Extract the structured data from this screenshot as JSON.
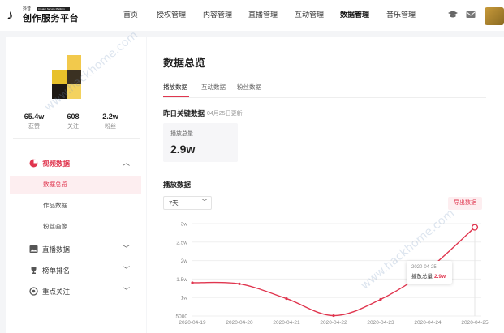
{
  "logo": {
    "small_text": "抖音",
    "badge_text": "Creator Service Platform",
    "title": "创作服务平台",
    "mark": "♪"
  },
  "nav": {
    "items": [
      {
        "label": "首页",
        "active": false
      },
      {
        "label": "授权管理",
        "active": false
      },
      {
        "label": "内容管理",
        "active": false
      },
      {
        "label": "直播管理",
        "active": false
      },
      {
        "label": "互动管理",
        "active": false
      },
      {
        "label": "数据管理",
        "active": true
      },
      {
        "label": "音乐管理",
        "active": false
      }
    ],
    "icons": [
      "graduation-cap-icon",
      "mail-icon"
    ]
  },
  "profile": {
    "stats": [
      {
        "value": "65.4w",
        "label": "获赞"
      },
      {
        "value": "608",
        "label": "关注"
      },
      {
        "value": "2.2w",
        "label": "粉丝"
      }
    ]
  },
  "sidebar": {
    "groups": [
      {
        "label": "视频数据",
        "icon": "pie-chart-icon",
        "expanded": true,
        "active": true,
        "children": [
          {
            "label": "数据总览",
            "active": true
          },
          {
            "label": "作品数据",
            "active": false
          },
          {
            "label": "粉丝画像",
            "active": false
          }
        ]
      },
      {
        "label": "直播数据",
        "icon": "image-icon",
        "expanded": false
      },
      {
        "label": "榜单排名",
        "icon": "trophy-icon",
        "expanded": false
      },
      {
        "label": "重点关注",
        "icon": "target-icon",
        "expanded": false
      }
    ]
  },
  "main": {
    "title": "数据总览",
    "tabs": [
      {
        "label": "播放数据",
        "active": true
      },
      {
        "label": "互动数据",
        "active": false
      },
      {
        "label": "粉丝数据",
        "active": false
      }
    ],
    "yesterday_title": "昨日关键数据",
    "yesterday_sub": "04月25日更新",
    "kpi": {
      "label": "播放总量",
      "value": "2.9w"
    },
    "play_title": "播放数据",
    "range_select": "7天",
    "export_label": "导出数据",
    "tooltip": {
      "date": "2020-04-25",
      "label": "播放总量",
      "value": "2.9w"
    }
  },
  "watermark": "www.hackhome.com",
  "colors": {
    "accent": "#e0364f",
    "accent_light": "#fdeef0"
  },
  "chart_data": {
    "type": "line",
    "x": [
      "2020-04-19",
      "2020-04-20",
      "2020-04-21",
      "2020-04-22",
      "2020-04-23",
      "2020-04-24",
      "2020-04-25"
    ],
    "series": [
      {
        "values": [
          14000,
          13700,
          9700,
          5100,
          9500,
          17500,
          29000
        ]
      }
    ],
    "ytick_labels": [
      "5000",
      "1w",
      "1.5w",
      "2w",
      "2.5w",
      "3w"
    ],
    "ytick_values": [
      5000,
      10000,
      15000,
      20000,
      25000,
      30000
    ],
    "ylim": [
      5000,
      30000
    ],
    "grid": true,
    "highlight_index": 6
  }
}
